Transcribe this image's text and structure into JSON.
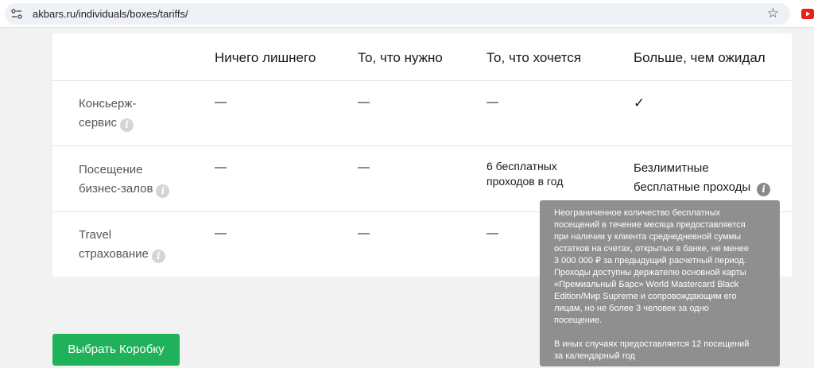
{
  "browser": {
    "url": "akbars.ru/individuals/boxes/tariffs/",
    "star_glyph": "☆"
  },
  "table": {
    "columns": [
      "Ничего лишнего",
      "То, что нужно",
      "То, что хочется",
      "Больше, чем ожидал"
    ],
    "rows": [
      {
        "label_line1": "Консьерж-",
        "label_line2": "сервис",
        "cells": [
          {
            "l1": "—",
            "l2": ""
          },
          {
            "l1": "—",
            "l2": ""
          },
          {
            "l1": "—",
            "l2": ""
          },
          {
            "l1": "✓",
            "l2": ""
          }
        ]
      },
      {
        "label_line1": "Посещение",
        "label_line2": "бизнес-залов",
        "cells": [
          {
            "l1": "—",
            "l2": ""
          },
          {
            "l1": "—",
            "l2": ""
          },
          {
            "l1": "6 бесплатных",
            "l2": "проходов в год"
          },
          {
            "l1": "Безлимитные",
            "l2": "бесплатные проходы"
          }
        ]
      },
      {
        "label_line1": "Travel",
        "label_line2": "страхование",
        "cells": [
          {
            "l1": "—",
            "l2": ""
          },
          {
            "l1": "—",
            "l2": ""
          },
          {
            "l1": "—",
            "l2": ""
          },
          {
            "l1": "",
            "l2": ""
          }
        ]
      }
    ],
    "info_glyph": "i"
  },
  "button": {
    "label": "Выбрать Коробку"
  },
  "tooltip": {
    "lines": [
      "Неограниченное количество бесплатных",
      "посещений в течение месяца предоставляется",
      "при наличии у клиента среднедневной суммы",
      "остатков на счетах, открытых в банке, не менее",
      "3 000 000 ₽ за предыдущий расчетный период.",
      "Проходы доступны держателю основной карты",
      "«Премиальный Барс» World Mastercard Black",
      "Edition/Мир Supreme и сопровождающим его",
      "лицам, но не более 3 человек за одно",
      "посещение."
    ],
    "lines2": [
      "В иных случаях предоставляется 12 посещений",
      "за календарный год"
    ]
  },
  "colors": {
    "accent_green": "#1fb25a",
    "tooltip_bg": "#8f8f8f",
    "page_bg": "#f2f2f2"
  }
}
